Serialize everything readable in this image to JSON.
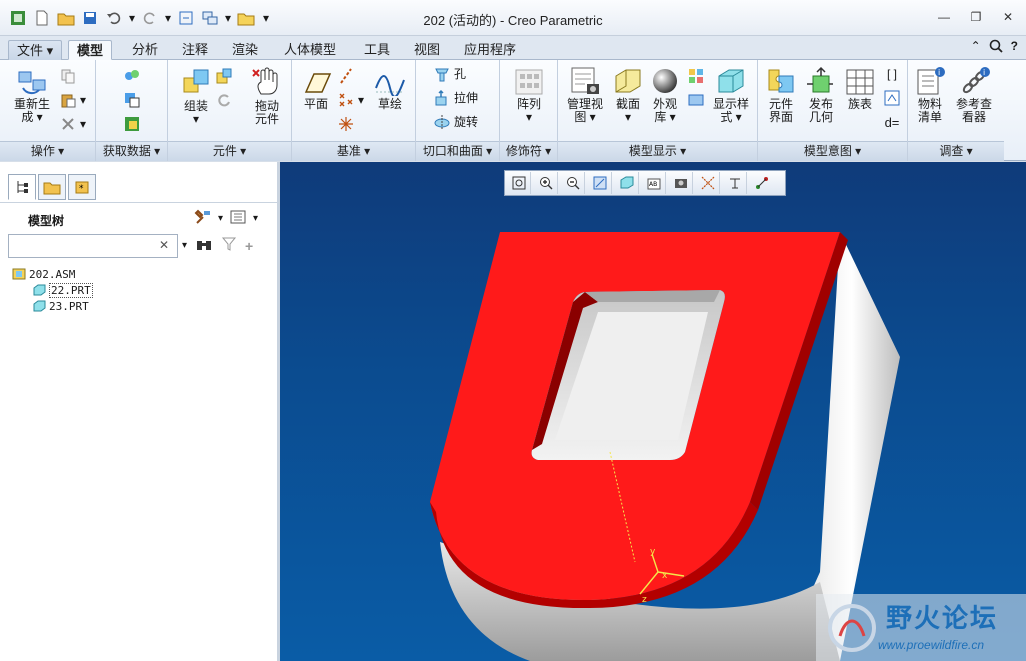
{
  "window": {
    "title": "202 (活动的) - Creo Parametric"
  },
  "tabs": [
    {
      "label": "文件",
      "id": "file"
    },
    {
      "label": "模型",
      "id": "model"
    },
    {
      "label": "分析",
      "id": "analysis"
    },
    {
      "label": "注释",
      "id": "annotate"
    },
    {
      "label": "渲染",
      "id": "render"
    },
    {
      "label": "人体模型",
      "id": "manikin"
    },
    {
      "label": "工具",
      "id": "tools"
    },
    {
      "label": "视图",
      "id": "view"
    },
    {
      "label": "应用程序",
      "id": "apps"
    }
  ],
  "groups": {
    "operations": "操作",
    "get_data": "获取数据",
    "component": "元件",
    "datum": "基准",
    "cut_surface": "切口和曲面",
    "modifiers": "修饰符",
    "model_display": "模型显示",
    "model_intent": "模型意图",
    "investigate": "调查"
  },
  "buttons": {
    "regenerate_l1": "重新生",
    "regenerate_l2": "成",
    "assemble": "组装",
    "drag_l1": "拖动",
    "drag_l2": "元件",
    "plane": "平面",
    "sketch": "草绘",
    "hole": "孔",
    "extrude": "拉伸",
    "revolve": "旋转",
    "pattern": "阵列",
    "manage_views_l1": "管理视",
    "manage_views_l2": "图",
    "section": "截面",
    "appearance_l1": "外观",
    "appearance_l2": "库",
    "display_style_l1": "显示样",
    "display_style_l2": "式",
    "comp_interface_l1": "元件",
    "comp_interface_l2": "界面",
    "publish_geom_l1": "发布",
    "publish_geom_l2": "几何",
    "family_table": "族表",
    "bom_l1": "物料",
    "bom_l2": "清单",
    "ref_viewer_l1": "参考查",
    "ref_viewer_l2": "看器"
  },
  "left_panel": {
    "title": "模型树",
    "search_value": "",
    "tree": [
      {
        "label": "202.ASM",
        "level": 0
      },
      {
        "label": "22.PRT",
        "level": 1
      },
      {
        "label": "23.PRT",
        "level": 1
      }
    ]
  },
  "watermark": {
    "cn": "野火论坛",
    "url": "www.proewildfire.cn"
  },
  "colors": {
    "model_red": "#ff1a1a",
    "model_gray": "#c8c8c8",
    "viewport_top": "#0f3b7a",
    "viewport_bottom": "#0a5ca6"
  }
}
